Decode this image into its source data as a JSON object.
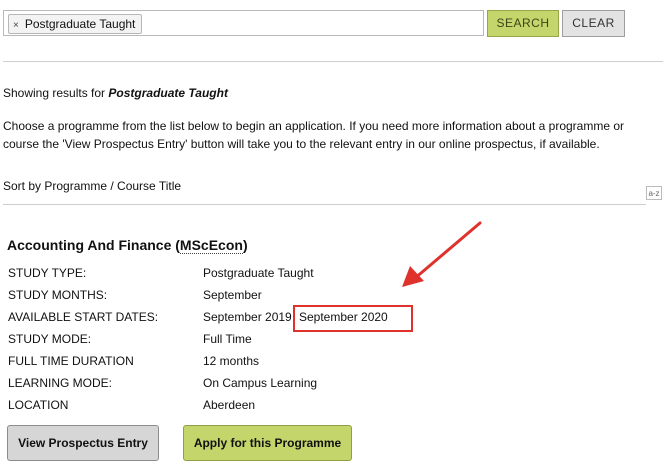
{
  "search": {
    "tag_label": "Postgraduate Taught",
    "tag_remove": "×",
    "search_button": "SEARCH",
    "clear_button": "CLEAR"
  },
  "results": {
    "showing_prefix": "Showing results for ",
    "showing_query": "Postgraduate Taught",
    "intro_line1": "Choose a programme from the list below to begin an application. If you need more information about a programme or",
    "intro_line2": "course the 'View Prospectus Entry' button will take you to the relevant entry in our online prospectus, if available.",
    "sort_label": "Sort by Programme / Course Title",
    "sort_icon_text": "a-z"
  },
  "programme": {
    "title": "Accounting And Finance (",
    "title_abbr": "MScEcon",
    "title_close": ")",
    "rows": [
      {
        "label": "STUDY TYPE:",
        "value": "Postgraduate Taught"
      },
      {
        "label": "STUDY MONTHS:",
        "value": "September"
      },
      {
        "label": "AVAILABLE START DATES:",
        "value": "September 2019"
      },
      {
        "label": "STUDY MODE:",
        "value": "Full Time"
      },
      {
        "label": "FULL TIME DURATION",
        "value": "12 months"
      },
      {
        "label": "LEARNING MODE:",
        "value": "On Campus Learning"
      },
      {
        "label": "LOCATION",
        "value": "Aberdeen"
      }
    ],
    "extra_start_date": "September 2020",
    "prospectus_button": "View Prospectus Entry",
    "apply_button": "Apply for this Programme"
  },
  "colors": {
    "accent_green": "#c3d56b",
    "annotation_red": "#e0322c"
  }
}
